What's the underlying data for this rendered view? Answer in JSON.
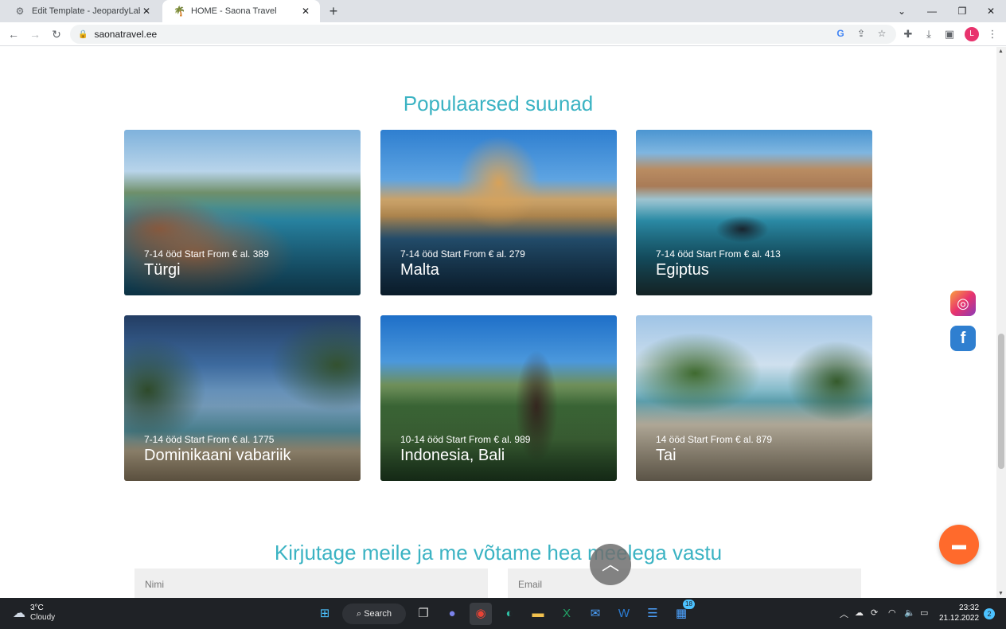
{
  "browser": {
    "tabs": [
      {
        "title": "Edit Template - JeopardyLabs",
        "icon": "gear-icon",
        "active": false
      },
      {
        "title": "HOME - Saona Travel",
        "icon": "palm-icon",
        "active": true
      }
    ],
    "new_tab_icon": "plus-icon",
    "address": "saonatravel.ee",
    "profile_initial": "L"
  },
  "page": {
    "section_title": "Populaarsed suunad",
    "destinations": [
      {
        "meta": "7-14 ööd Start From € al. 389",
        "name": "Türgi",
        "scene": "turkey"
      },
      {
        "meta": "7-14 ööd Start From € al. 279",
        "name": "Malta",
        "scene": "malta"
      },
      {
        "meta": "7-14 ööd Start From € al. 413",
        "name": "Egiptus",
        "scene": "egypt"
      },
      {
        "meta": "7-14 ööd Start From € al. 1775",
        "name": "Dominikaani vabariik",
        "scene": "domrep"
      },
      {
        "meta": "10-14 ööd Start From € al. 989",
        "name": "Indonesia, Bali",
        "scene": "bali"
      },
      {
        "meta": "14 ööd Start From € al. 879",
        "name": "Tai",
        "scene": "thai"
      }
    ],
    "contact_title": "Kirjutage meile ja me võtame hea meelega vastu",
    "contact_form": {
      "name_placeholder": "Nimi",
      "email_placeholder": "Email"
    },
    "social": [
      "instagram-icon",
      "facebook-icon"
    ],
    "accent_color": "#3bb3c3",
    "chat_color": "#ff6a2c"
  },
  "taskbar": {
    "weather_temp": "3°C",
    "weather_desc": "Cloudy",
    "search_label": "Search",
    "badge_count": "18",
    "time": "23:32",
    "date": "21.12.2022",
    "notification_count": "2"
  }
}
